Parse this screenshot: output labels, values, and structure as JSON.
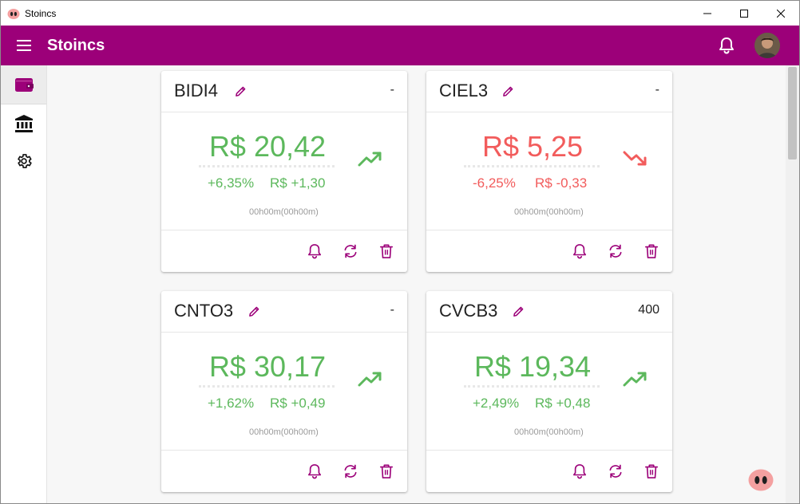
{
  "window": {
    "title": "Stoincs"
  },
  "appbar": {
    "title": "Stoincs"
  },
  "rail": {
    "items": [
      "wallet",
      "bank",
      "settings"
    ]
  },
  "colors": {
    "primary": "#9c0079",
    "positive": "#5cb85c",
    "negative": "#f25c5c"
  },
  "cards": [
    {
      "ticker": "BIDI4",
      "quantity": "-",
      "price": "R$ 20,42",
      "pct": "+6,35%",
      "diff": "R$ +1,30",
      "time": "00h00m(00h00m)",
      "trend": "up"
    },
    {
      "ticker": "CIEL3",
      "quantity": "-",
      "price": "R$ 5,25",
      "pct": "-6,25%",
      "diff": "R$ -0,33",
      "time": "00h00m(00h00m)",
      "trend": "down"
    },
    {
      "ticker": "CNTO3",
      "quantity": "-",
      "price": "R$ 30,17",
      "pct": "+1,62%",
      "diff": "R$ +0,49",
      "time": "00h00m(00h00m)",
      "trend": "up"
    },
    {
      "ticker": "CVCB3",
      "quantity": "400",
      "price": "R$ 19,34",
      "pct": "+2,49%",
      "diff": "R$ +0,48",
      "time": "00h00m(00h00m)",
      "trend": "up"
    }
  ]
}
